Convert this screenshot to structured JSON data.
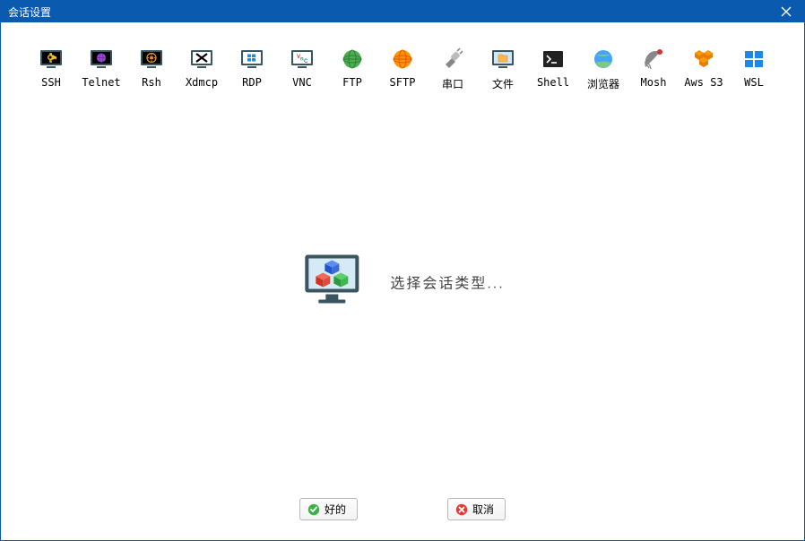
{
  "window": {
    "title": "会话设置"
  },
  "session_types": [
    {
      "id": "ssh",
      "label": "SSH"
    },
    {
      "id": "telnet",
      "label": "Telnet"
    },
    {
      "id": "rsh",
      "label": "Rsh"
    },
    {
      "id": "xdmcp",
      "label": "Xdmcp"
    },
    {
      "id": "rdp",
      "label": "RDP"
    },
    {
      "id": "vnc",
      "label": "VNC"
    },
    {
      "id": "ftp",
      "label": "FTP"
    },
    {
      "id": "sftp",
      "label": "SFTP"
    },
    {
      "id": "serial",
      "label": "串口"
    },
    {
      "id": "file",
      "label": "文件"
    },
    {
      "id": "shell",
      "label": "Shell"
    },
    {
      "id": "browser",
      "label": "浏览器"
    },
    {
      "id": "mosh",
      "label": "Mosh"
    },
    {
      "id": "awss3",
      "label": "Aws S3"
    },
    {
      "id": "wsl",
      "label": "WSL"
    }
  ],
  "center": {
    "prompt": "选择会话类型..."
  },
  "buttons": {
    "ok": "好的",
    "cancel": "取消"
  }
}
